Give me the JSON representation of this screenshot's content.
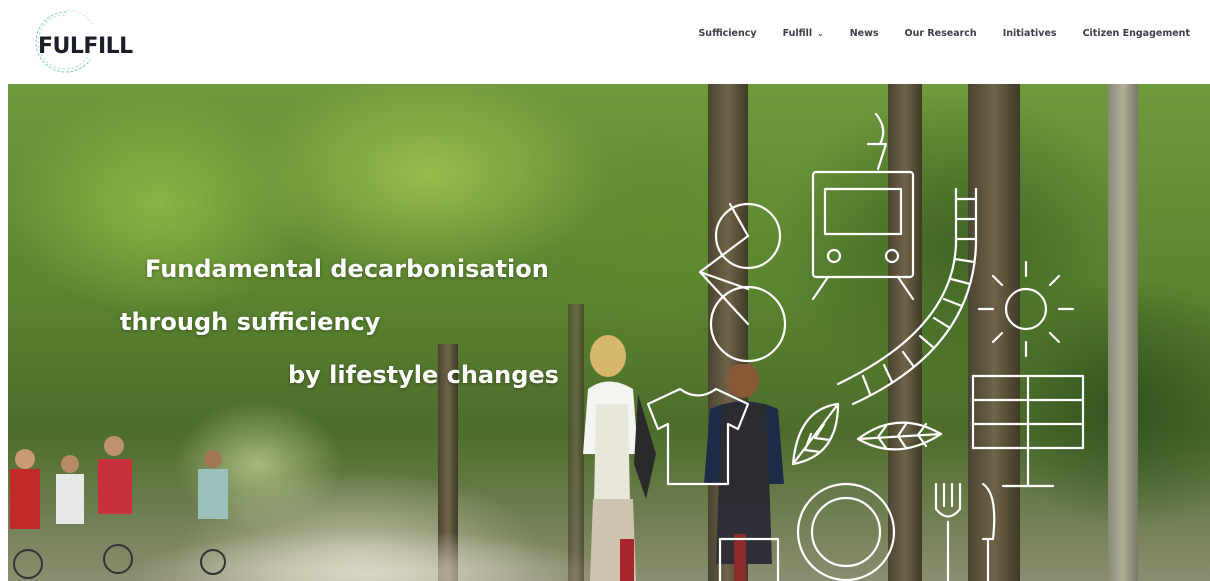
{
  "brand": {
    "name": "FULFILL"
  },
  "nav": {
    "items": [
      {
        "label": "Sufficiency",
        "has_dropdown": false
      },
      {
        "label": "Fulfill",
        "has_dropdown": true
      },
      {
        "label": "News",
        "has_dropdown": false
      },
      {
        "label": "Our Research",
        "has_dropdown": false
      },
      {
        "label": "Initiatives",
        "has_dropdown": false
      },
      {
        "label": "Citizen Engagement",
        "has_dropdown": false
      }
    ]
  },
  "hero": {
    "line1": "Fundamental decarbonisation",
    "line2": "through sufficiency",
    "line3": "by lifestyle changes",
    "illustration_icons": [
      "tram-icon",
      "bicycle-icon",
      "railway-track-icon",
      "sun-icon",
      "shirt-icon",
      "leaf-icon",
      "leaf-icon",
      "solar-panel-icon",
      "plate-icon",
      "fork-icon",
      "knife-icon"
    ]
  },
  "colors": {
    "text_dark": "#1a1f2b",
    "nav_text": "#3a3f4a",
    "logo_accent": "#7fd3c3",
    "headline": "#ffffff"
  }
}
